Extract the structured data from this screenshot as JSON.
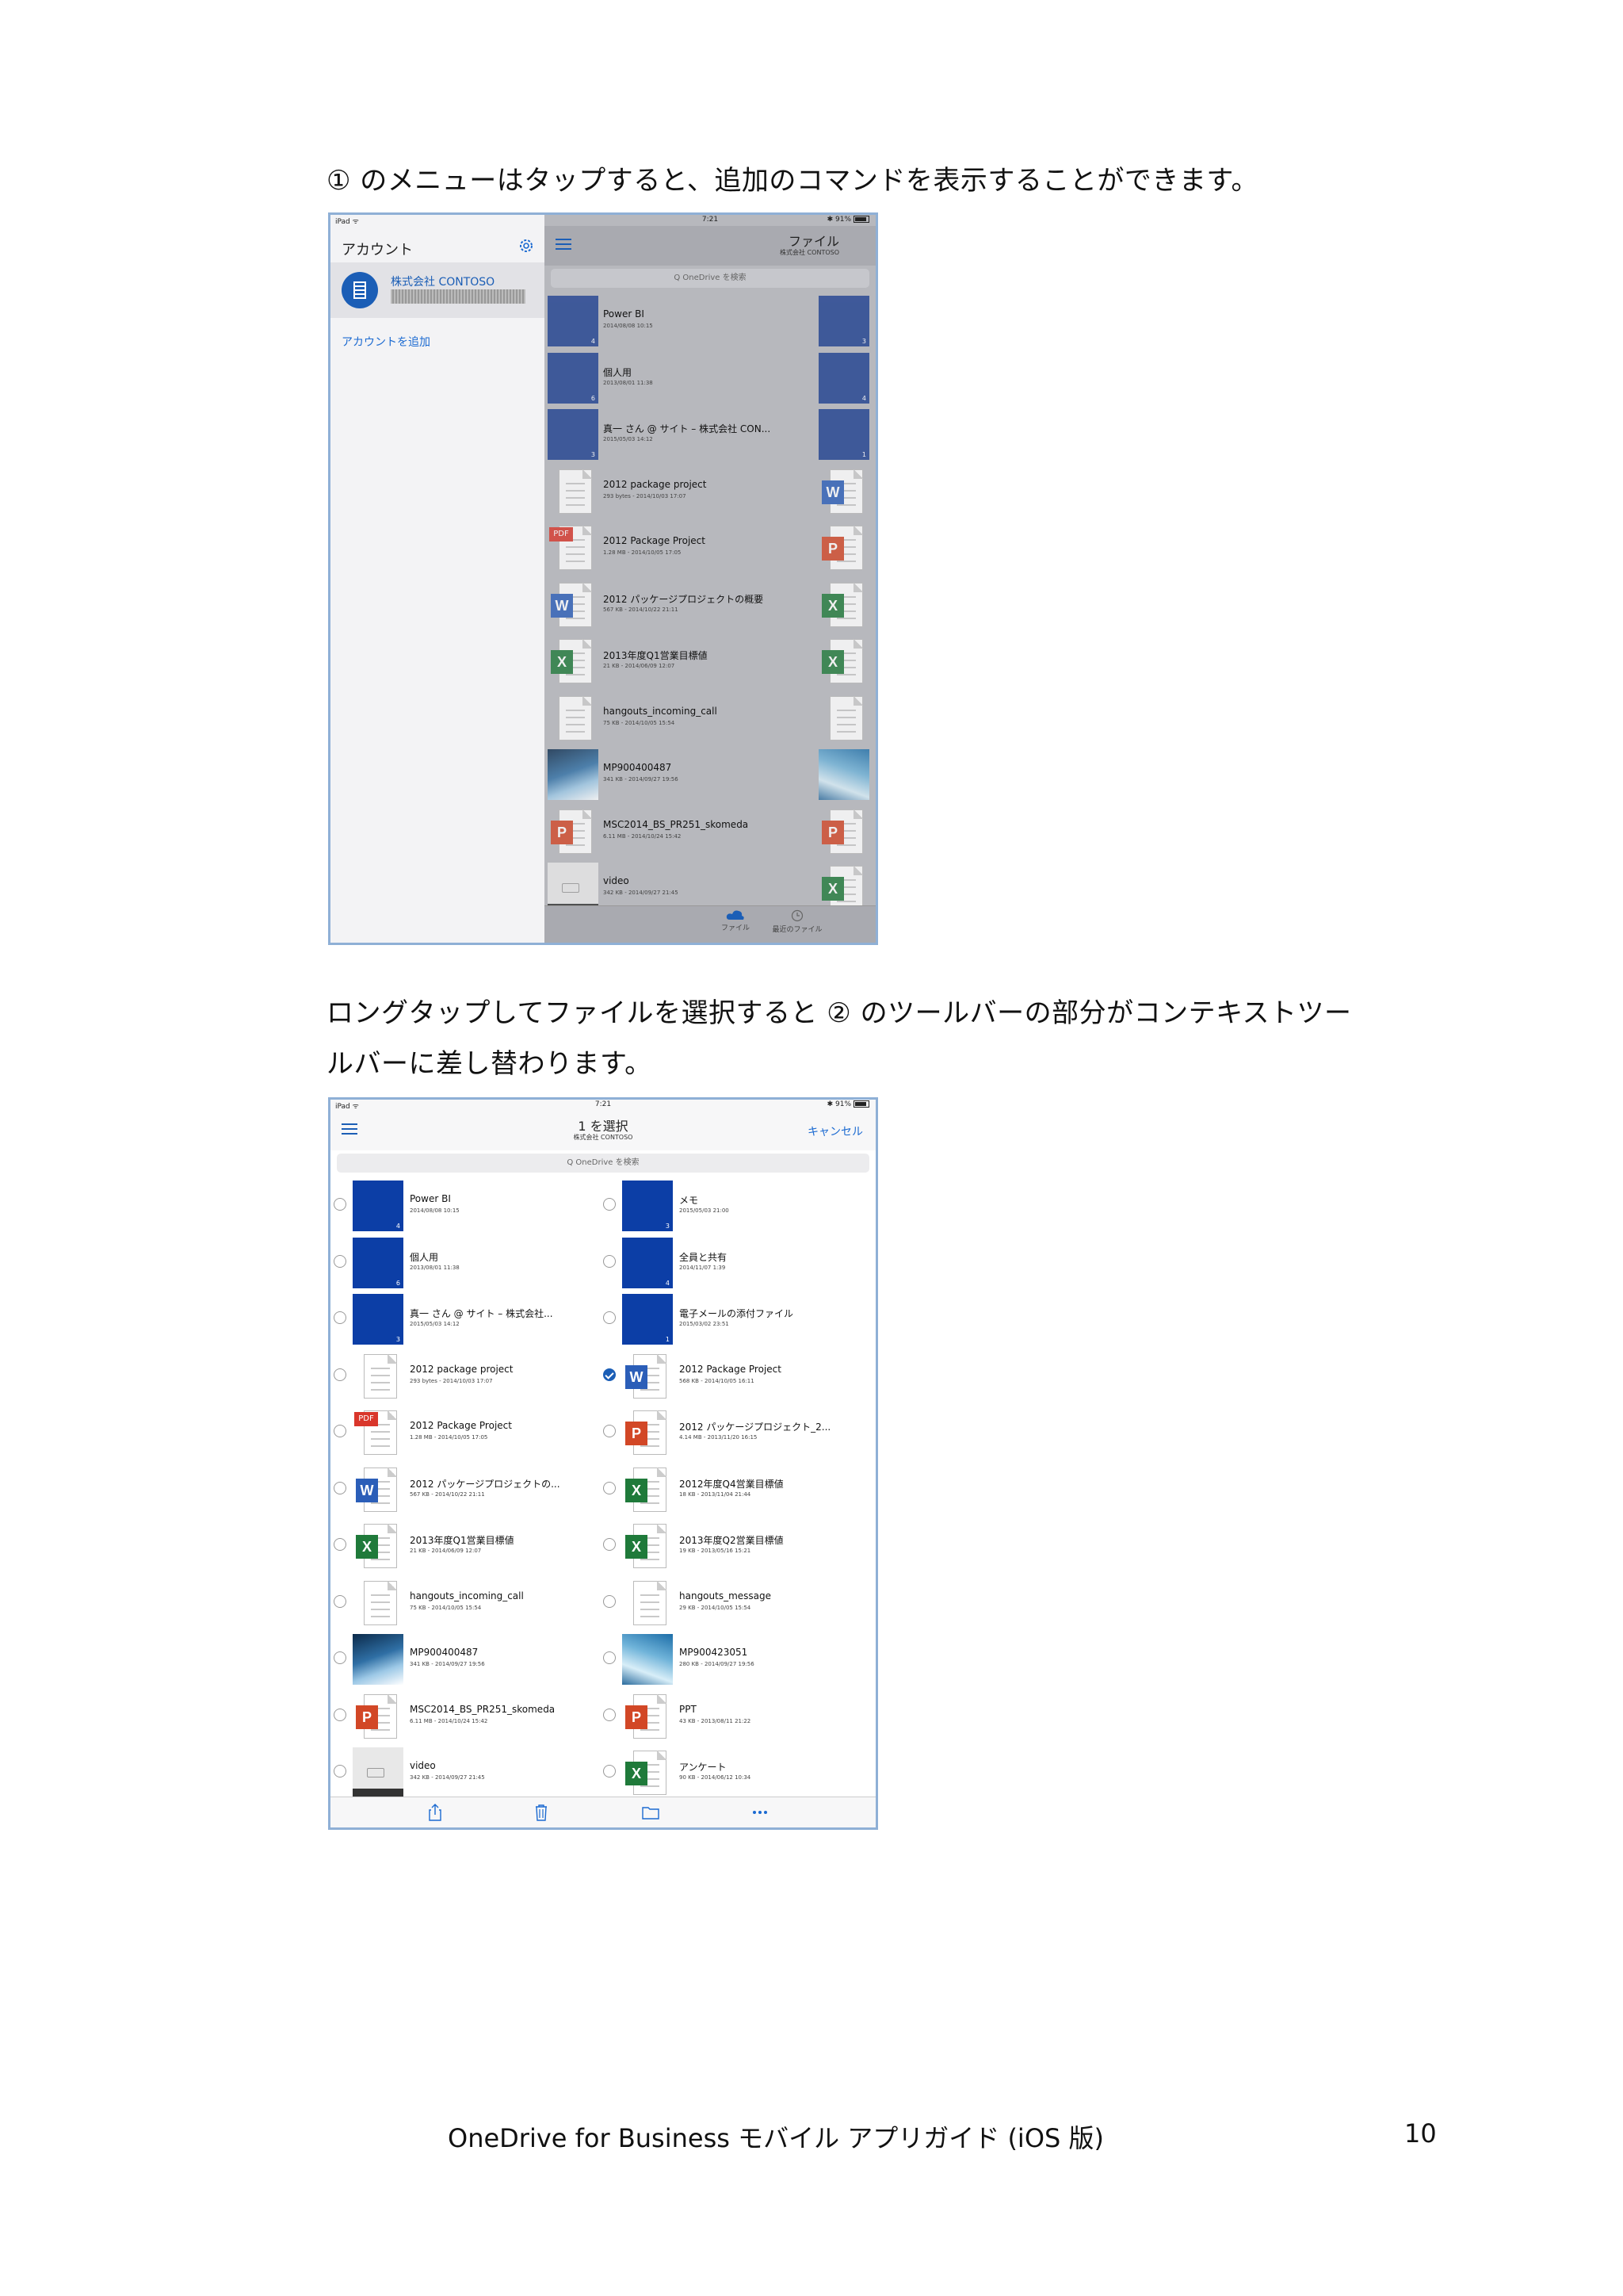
{
  "paragraph1": "① のメニューはタップすると、追加のコマンドを表示することができます。",
  "paragraph2_line1": "ロングタップしてファイルを選択すると ② のツールバーの部分がコンテキストツー",
  "paragraph2_line2": "ルバーに差し替わります。",
  "footer": "OneDrive  for  Business  モバイル  アプリガイド  (iOS 版)",
  "page_number": "10",
  "shot1": {
    "status": {
      "device": "iPad ᯤ",
      "time": "7:21",
      "battery": "✱ 91%"
    },
    "sidebar": {
      "title": "アカウント",
      "account_name": "株式会社 CONTOSO",
      "add_account": "アカウントを追加"
    },
    "header": {
      "title": "ファイル",
      "subtitle": "株式会社 CONTOSO"
    },
    "search_placeholder": "Q OneDrive を検索",
    "items": [
      {
        "name": "Power BI",
        "meta": "2014/08/08 10:15",
        "kind": "folder",
        "count": "4"
      },
      {
        "name": "個人用",
        "meta": "2013/08/01 11:38",
        "kind": "folder",
        "count": "6"
      },
      {
        "name": "真一 さん @ サイト – 株式会社 CON...",
        "meta": "2015/05/03 14:12",
        "kind": "folder",
        "count": "3"
      },
      {
        "name": "2012 package project",
        "meta": "293 bytes - 2014/10/03 17:07",
        "kind": "doc"
      },
      {
        "name": "2012 Package Project",
        "meta": "1.28 MB - 2014/10/05 17:05",
        "kind": "pdf"
      },
      {
        "name": "2012 パッケージプロジェクトの概要",
        "meta": "567 KB - 2014/10/22 21:11",
        "kind": "word"
      },
      {
        "name": "2013年度Q1営業目標値",
        "meta": "21 KB - 2014/06/09 12:07",
        "kind": "excel"
      },
      {
        "name": "hangouts_incoming_call",
        "meta": "75 KB - 2014/10/05 15:54",
        "kind": "blank"
      },
      {
        "name": "MP900400487",
        "meta": "341 KB - 2014/09/27 19:56",
        "kind": "photo1"
      },
      {
        "name": "MSC2014_BS_PR251_skomeda",
        "meta": "6.11 MB - 2014/10/24 15:42",
        "kind": "ppt"
      },
      {
        "name": "video",
        "meta": "342 KB - 2014/09/27 21:45",
        "kind": "video"
      }
    ],
    "right_col": [
      {
        "kind": "folder",
        "count": "3"
      },
      {
        "kind": "folder",
        "count": "4"
      },
      {
        "kind": "folder",
        "count": "1"
      },
      {
        "kind": "word"
      },
      {
        "kind": "ppt"
      },
      {
        "kind": "excel"
      },
      {
        "kind": "excel"
      },
      {
        "kind": "blank"
      },
      {
        "kind": "photo2"
      },
      {
        "kind": "ppt"
      },
      {
        "kind": "excel"
      }
    ],
    "tabs": [
      {
        "label": "ファイル"
      },
      {
        "label": "最近のファイル"
      }
    ]
  },
  "shot2": {
    "status": {
      "device": "iPad ᯤ",
      "time": "7:21",
      "battery": "✱ 91%"
    },
    "header": {
      "title": "1 を選択",
      "subtitle": "株式会社 CONTOSO",
      "cancel": "キャンセル"
    },
    "search_placeholder": "Q OneDrive を検索",
    "left": [
      {
        "name": "Power BI",
        "meta": "2014/08/08 10:15",
        "kind": "folder",
        "count": "4"
      },
      {
        "name": "個人用",
        "meta": "2013/08/01 11:38",
        "kind": "folder",
        "count": "6"
      },
      {
        "name": "真一 さん @ サイト – 株式会社...",
        "meta": "2015/05/03 14:12",
        "kind": "folder",
        "count": "3"
      },
      {
        "name": "2012 package project",
        "meta": "293 bytes - 2014/10/03 17:07",
        "kind": "doc"
      },
      {
        "name": "2012 Package Project",
        "meta": "1.28 MB - 2014/10/05 17:05",
        "kind": "pdf"
      },
      {
        "name": "2012 パッケージプロジェクトの...",
        "meta": "567 KB - 2014/10/22 21:11",
        "kind": "word"
      },
      {
        "name": "2013年度Q1営業目標値",
        "meta": "21 KB - 2014/06/09 12:07",
        "kind": "excel"
      },
      {
        "name": "hangouts_incoming_call",
        "meta": "75 KB - 2014/10/05 15:54",
        "kind": "blank"
      },
      {
        "name": "MP900400487",
        "meta": "341 KB - 2014/09/27 19:56",
        "kind": "photo1"
      },
      {
        "name": "MSC2014_BS_PR251_skomeda",
        "meta": "6.11 MB - 2014/10/24 15:42",
        "kind": "ppt"
      },
      {
        "name": "video",
        "meta": "342 KB - 2014/09/27 21:45",
        "kind": "video"
      }
    ],
    "right": [
      {
        "name": "メモ",
        "meta": "2015/05/03 21:00",
        "kind": "folder",
        "count": "3"
      },
      {
        "name": "全員と共有",
        "meta": "2014/11/07 1:39",
        "kind": "folder",
        "count": "4"
      },
      {
        "name": "電子メールの添付ファイル",
        "meta": "2015/03/02 23:51",
        "kind": "folder",
        "count": "1"
      },
      {
        "name": "2012 Package Project",
        "meta": "568 KB - 2014/10/05 16:11",
        "kind": "word",
        "selected": true
      },
      {
        "name": "2012 パッケージプロジェクト_2...",
        "meta": "4.14 MB - 2013/11/20 16:15",
        "kind": "ppt"
      },
      {
        "name": "2012年度Q4営業目標値",
        "meta": "18 KB - 2013/11/04 21:44",
        "kind": "excel"
      },
      {
        "name": "2013年度Q2営業目標値",
        "meta": "19 KB - 2013/05/16 15:21",
        "kind": "excel"
      },
      {
        "name": "hangouts_message",
        "meta": "29 KB - 2014/10/05 15:54",
        "kind": "blank"
      },
      {
        "name": "MP900423051",
        "meta": "280 KB - 2014/09/27 19:56",
        "kind": "photo2"
      },
      {
        "name": "PPT",
        "meta": "43 KB - 2013/08/11 21:22",
        "kind": "ppt"
      },
      {
        "name": "アンケート",
        "meta": "90 KB - 2014/06/12 10:34",
        "kind": "excel"
      }
    ],
    "toolbar": [
      {
        "icon": "share-icon"
      },
      {
        "icon": "trash-icon"
      },
      {
        "icon": "folder-icon"
      },
      {
        "icon": "more-icon"
      }
    ]
  }
}
